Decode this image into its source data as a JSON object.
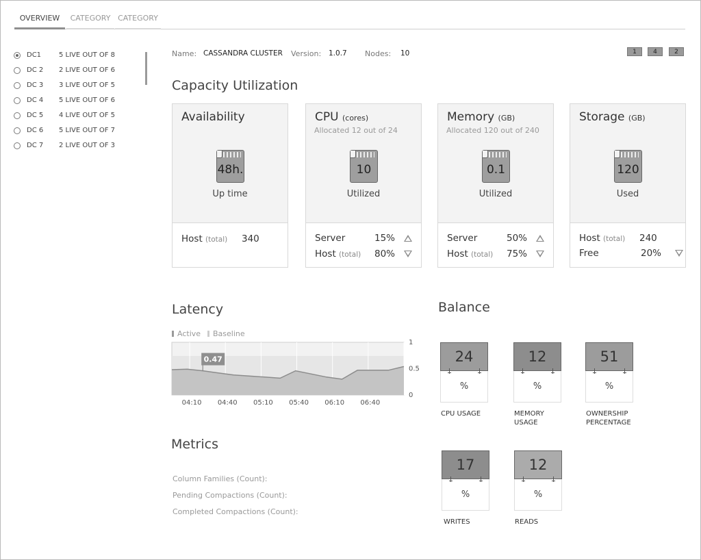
{
  "tabs": [
    {
      "label": "OVERVIEW",
      "active": true
    },
    {
      "label": "CATEGORY",
      "active": false
    },
    {
      "label": "CATEGORY",
      "active": false
    }
  ],
  "sidebar": {
    "datacenters": [
      {
        "name": "DC1",
        "live": "5 LIVE OUT OF 8",
        "selected": true
      },
      {
        "name": "DC 2",
        "live": "2 LIVE OUT OF 6",
        "selected": false
      },
      {
        "name": "DC 3",
        "live": "3 LIVE OUT OF 5",
        "selected": false
      },
      {
        "name": "DC 4",
        "live": "5 LIVE OUT OF 6",
        "selected": false
      },
      {
        "name": "DC 5",
        "live": "4 LIVE OUT OF 5",
        "selected": false
      },
      {
        "name": "DC 6",
        "live": "5 LIVE OUT OF 7",
        "selected": false
      },
      {
        "name": "DC 7",
        "live": "2 LIVE OUT OF 3",
        "selected": false
      }
    ]
  },
  "info": {
    "name_label": "Name:",
    "name_value": "CASSANDRA CLUSTER",
    "version_label": "Version:",
    "version_value": "1.0.7",
    "nodes_label": "Nodes:",
    "nodes_value": "10"
  },
  "pager": [
    "1",
    "4",
    "2"
  ],
  "capacity": {
    "title": "Capacity Utilization",
    "cards": [
      {
        "title": "Availability",
        "unit": "",
        "subtitle": "",
        "chip_value": "48h.",
        "chip_label": "Up time",
        "rows": [
          {
            "label": "Host",
            "qualifier": "(total)",
            "value": "340",
            "trend": ""
          }
        ]
      },
      {
        "title": "CPU",
        "unit": "(cores)",
        "subtitle": "Allocated 12 out of 24",
        "chip_value": "10",
        "chip_label": "Utilized",
        "rows": [
          {
            "label": "Server",
            "qualifier": "",
            "value": "15%",
            "trend": "up"
          },
          {
            "label": "Host",
            "qualifier": "(total)",
            "value": "80%",
            "trend": "down"
          }
        ]
      },
      {
        "title": "Memory",
        "unit": "(GB)",
        "subtitle": "Allocated 120 out of 240",
        "chip_value": "0.1",
        "chip_label": "Utilized",
        "rows": [
          {
            "label": "Server",
            "qualifier": "",
            "value": "50%",
            "trend": "up"
          },
          {
            "label": "Host",
            "qualifier": "(total)",
            "value": "75%",
            "trend": "down"
          }
        ]
      },
      {
        "title": "Storage",
        "unit": "(GB)",
        "subtitle": "",
        "chip_value": "120",
        "chip_label": "Used",
        "rows": [
          {
            "label": "Host",
            "qualifier": "(total)",
            "value": "240",
            "trend": ""
          },
          {
            "label": "Free",
            "qualifier": "",
            "value": "20%",
            "trend": "down"
          }
        ]
      }
    ]
  },
  "latency": {
    "title": "Latency",
    "legend": [
      {
        "label": "Active",
        "color": "#9a9a9a"
      },
      {
        "label": "Baseline",
        "color": "#cccccc"
      }
    ],
    "tooltip": "0.47",
    "chart_data": {
      "type": "area",
      "x": [
        "04:10",
        "04:40",
        "05:10",
        "05:40",
        "06:10",
        "06:40"
      ],
      "x_ticks": [
        "04:10",
        "04:40",
        "05:10",
        "05:40",
        "06:10",
        "06:40"
      ],
      "series": [
        {
          "name": "Active",
          "values": [
            0.48,
            0.49,
            0.46,
            0.42,
            0.38,
            0.36,
            0.34,
            0.32,
            0.46,
            0.4,
            0.34,
            0.3,
            0.47,
            0.47,
            0.47,
            0.54
          ]
        }
      ],
      "baseline_band": [
        0.1,
        0.74
      ],
      "y_ticks": [
        "0",
        "0.5",
        "1"
      ],
      "ylim": [
        0,
        1
      ],
      "highlight_value": "0.47"
    }
  },
  "metrics": {
    "title": "Metrics",
    "items": [
      "Column Families (Count):",
      "Pending Compactions (Count):",
      "Completed Compactions (Count):"
    ]
  },
  "balance": {
    "title": "Balance",
    "items": [
      {
        "value": "24",
        "unit": "%",
        "label_lines": [
          "CPU USAGE"
        ],
        "level": 0.24
      },
      {
        "value": "12",
        "unit": "%",
        "label_lines": [
          "MEMORY",
          "USAGE"
        ],
        "level": 0.12
      },
      {
        "value": "51",
        "unit": "%",
        "label_lines": [
          "OWNERSHIP",
          "PERCENTAGE"
        ],
        "level": 0.51
      },
      {
        "value": "17",
        "unit": "%",
        "label_lines": [
          "WRITES"
        ],
        "level": 0.17
      },
      {
        "value": "12",
        "unit": "%",
        "label_lines": [
          "READS"
        ],
        "level": 0.12
      }
    ]
  }
}
